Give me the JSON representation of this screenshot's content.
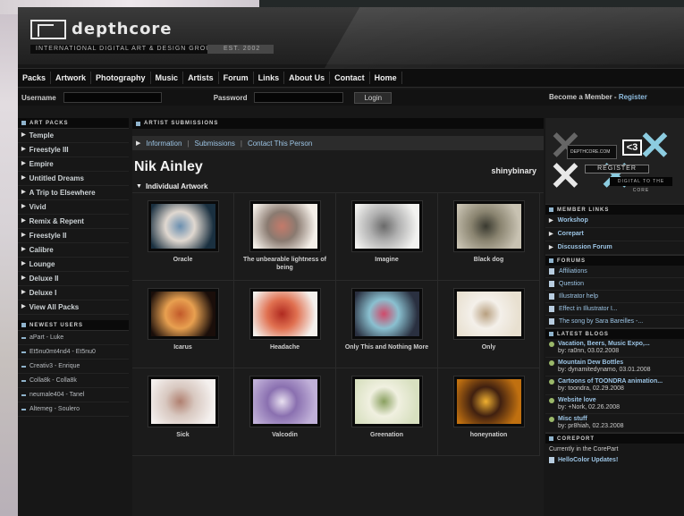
{
  "site": {
    "logo_text": "depthcore",
    "tagline": "INTERNATIONAL DIGITAL ART & DESIGN GROUP",
    "est": "EST. 2002"
  },
  "nav": [
    "Packs",
    "Artwork",
    "Photography",
    "Music",
    "Artists",
    "Forum",
    "Links",
    "About Us",
    "Contact",
    "Home"
  ],
  "login": {
    "username_label": "Username",
    "password_label": "Password",
    "button": "Login",
    "member_text": "Become a Member - ",
    "register": "Register"
  },
  "art_packs": {
    "header": "ART PACKS",
    "items": [
      "Temple",
      "Freestyle III",
      "Empire",
      "Untitled Dreams",
      "A Trip to Elsewhere",
      "Vivid",
      "Remix & Repent",
      "Freestyle II",
      "Calibre",
      "Lounge",
      "Deluxe II",
      "Deluxe I",
      "View All Packs"
    ]
  },
  "newest_users": {
    "header": "NEWEST USERS",
    "items": [
      "aPart - Luke",
      "Et5nu0mt4nd4 - Et5nu0",
      "Creativ3 - Enrique",
      "Colla8k - Colla8k",
      "neumale404 - Tanel",
      "Altemeg - Soulero"
    ]
  },
  "main": {
    "header": "ARTIST SUBMISSIONS",
    "subnav": [
      "Information",
      "Submissions",
      "Contact This Person"
    ],
    "artist_name": "Nik Ainley",
    "username": "shinybinary",
    "section": "Individual Artwork",
    "artworks": [
      {
        "title": "Oracle",
        "colors": [
          "#1a3040",
          "#6a8fb0",
          "#e0d8d0"
        ]
      },
      {
        "title": "The unbearable lightness of being",
        "colors": [
          "#f4efe8",
          "#c47a6a",
          "#8a7a70"
        ]
      },
      {
        "title": "Imagine",
        "colors": [
          "#f2f2f0",
          "#6a6a6a",
          "#b0b0b0"
        ]
      },
      {
        "title": "Black dog",
        "colors": [
          "#c8c2b2",
          "#3a3a30",
          "#8a8470"
        ]
      },
      {
        "title": "Icarus",
        "colors": [
          "#1a0e0a",
          "#c25a2a",
          "#e8a050"
        ]
      },
      {
        "title": "Headache",
        "colors": [
          "#f4f0ec",
          "#b02a20",
          "#e07050"
        ]
      },
      {
        "title": "Only This and Nothing More",
        "colors": [
          "#2a3040",
          "#d04a6a",
          "#8ac0d0"
        ]
      },
      {
        "title": "Only",
        "colors": [
          "#e8e0d0",
          "#b8a080",
          "#f4f0ea"
        ]
      },
      {
        "title": "Sick",
        "colors": [
          "#f4f0ee",
          "#b08070",
          "#d8c8c0"
        ]
      },
      {
        "title": "Valcodin",
        "colors": [
          "#c0b0d8",
          "#e8e0f0",
          "#8a70b0"
        ]
      },
      {
        "title": "Greenation",
        "colors": [
          "#d8e0c0",
          "#8aa060",
          "#f0f0e0"
        ]
      },
      {
        "title": "honeynation",
        "colors": [
          "#c07010",
          "#f0b030",
          "#402010"
        ]
      }
    ]
  },
  "right": {
    "promo_box": "DEPTHCORE.COM",
    "promo_heart": "<3",
    "promo_register": "REGISTER",
    "promo_digital": "DIGITAL TO THE CORE",
    "member_links_header": "MEMBER LINKS",
    "member_links": [
      "Workshop",
      "Corepart",
      "Discussion Forum"
    ],
    "forums_header": "FORUMS",
    "forums": [
      "Affiliations",
      "Question",
      "Illustrator help",
      "Effect in Illustrator I...",
      "The song by Sara Bareilles -..."
    ],
    "blogs_header": "LATEST BLOGS",
    "blogs": [
      {
        "title": "Vacation, Beers, Music Expo,...",
        "by": "by: ra0nn, 03.02.2008"
      },
      {
        "title": "Mountain Dew Bottles",
        "by": "by: dynamitedynamo, 03.01.2008"
      },
      {
        "title": "Cartoons of TOONDRA animation...",
        "by": "by: toondra, 02.29.2008"
      },
      {
        "title": "Website love",
        "by": "by: +Nork, 02.26.2008"
      },
      {
        "title": "Misc stuff",
        "by": "by: pr8hiah, 02.23.2008"
      }
    ],
    "corepart_header": "COREPORT",
    "corepart_text": "Currently in the CorePart",
    "corepart_item": "HelloColor Updates!"
  }
}
